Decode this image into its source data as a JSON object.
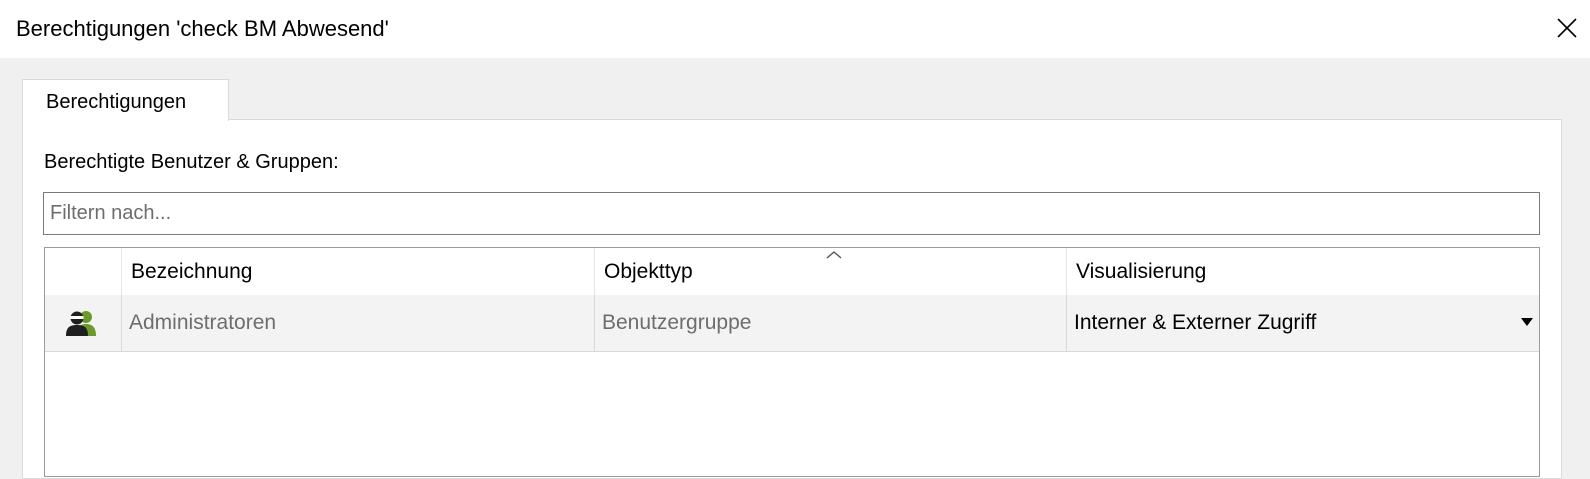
{
  "window": {
    "title": "Berechtigungen 'check BM Abwesend'",
    "close_icon": "close-icon"
  },
  "tabs": [
    {
      "label": "Berechtigungen",
      "active": true
    }
  ],
  "section": {
    "label": "Berechtigte Benutzer & Gruppen:"
  },
  "filter": {
    "value": "",
    "placeholder": "Filtern nach..."
  },
  "grid": {
    "sort_icon": "sort-ascending-icon",
    "columns": [
      {
        "key": "icon",
        "label": ""
      },
      {
        "key": "bezeichnung",
        "label": "Bezeichnung"
      },
      {
        "key": "objekttyp",
        "label": "Objekttyp"
      },
      {
        "key": "visualisierung",
        "label": "Visualisierung"
      }
    ],
    "rows": [
      {
        "icon": "user-group-icon",
        "bezeichnung": "Administratoren",
        "objekttyp": "Benutzergruppe",
        "visualisierung": "Interner & Externer Zugriff"
      }
    ]
  },
  "colors": {
    "title_bar_bg": "#ffffff",
    "window_bg": "#f0f0f0",
    "row_bg": "#f3f3f3",
    "muted_text": "#6d6d6d",
    "icon_green": "#6a9a2a"
  }
}
